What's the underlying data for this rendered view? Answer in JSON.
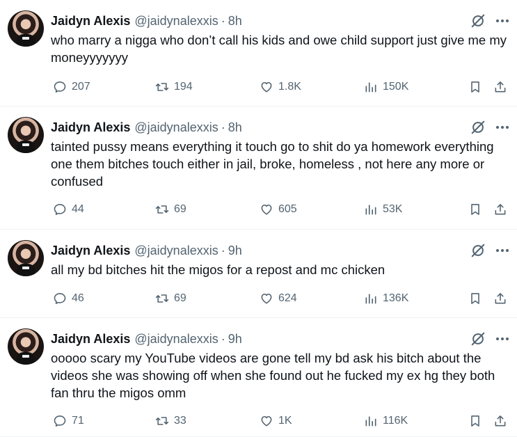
{
  "tweets": [
    {
      "name": "Jaidyn Alexis",
      "handle": "@jaidynalexxis",
      "separator": "·",
      "time": "8h",
      "text": "who marry a nigga who don’t call his kids and owe child support just give me my moneyyyyyyy",
      "replies": "207",
      "retweets": "194",
      "likes": "1.8K",
      "views": "150K"
    },
    {
      "name": "Jaidyn Alexis",
      "handle": "@jaidynalexxis",
      "separator": "·",
      "time": "8h",
      "text": "tainted pussy means everything it touch go to shit do ya homework everything one them bitches touch either in jail, broke, homeless , not here any more  or confused",
      "replies": "44",
      "retweets": "69",
      "likes": "605",
      "views": "53K"
    },
    {
      "name": "Jaidyn Alexis",
      "handle": "@jaidynalexxis",
      "separator": "·",
      "time": "9h",
      "text": "all my bd bitches hit the migos for a repost and mc chicken",
      "replies": "46",
      "retweets": "69",
      "likes": "624",
      "views": "136K"
    },
    {
      "name": "Jaidyn Alexis",
      "handle": "@jaidynalexxis",
      "separator": "·",
      "time": "9h",
      "text": "ooooo scary my YouTube videos are gone tell my bd ask his bitch about the videos she was showing off when she found out he fucked my ex hg they both fan thru the  migos omm",
      "replies": "71",
      "retweets": "33",
      "likes": "1K",
      "views": "116K"
    }
  ],
  "icons": {
    "reply": "speech-bubble-icon",
    "retweet": "retweet-arrows-icon",
    "like": "heart-icon",
    "views": "bar-chart-icon",
    "bookmark": "bookmark-icon",
    "share": "share-upload-icon",
    "grok": "grok-slash-icon",
    "more": "ellipsis-icon"
  },
  "colors": {
    "text": "#0f1419",
    "secondary": "#536471",
    "divider": "#eff3f4"
  }
}
